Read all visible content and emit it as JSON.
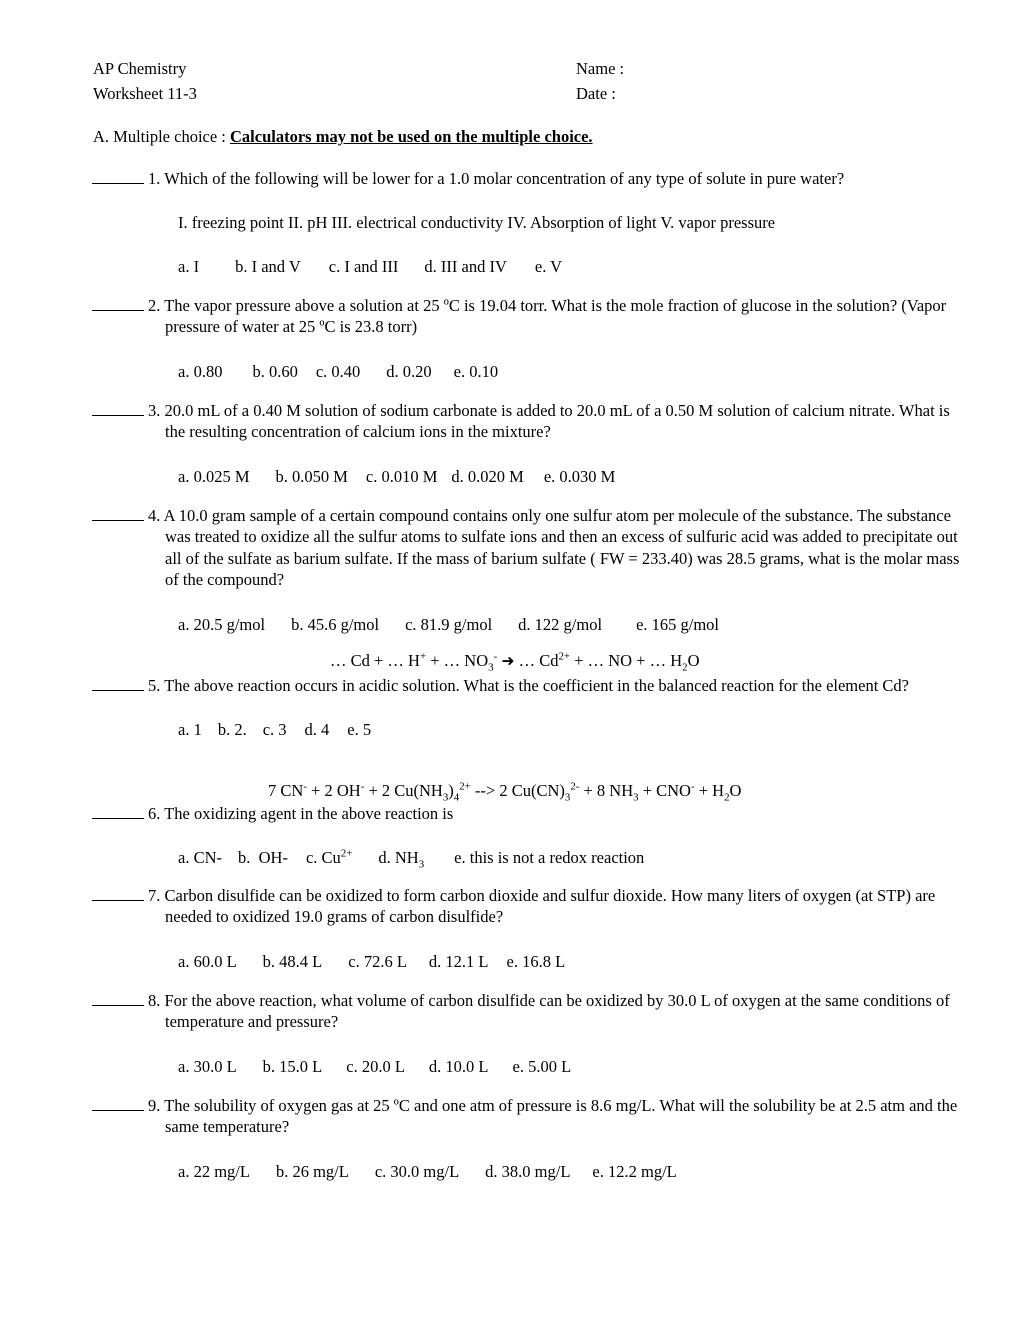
{
  "header": {
    "course": "AP Chemistry",
    "worksheet": "Worksheet 11-3",
    "name_label": "Name :",
    "date_label": "Date :"
  },
  "section": {
    "prefix": "A. Multiple choice : ",
    "emphasis": "Calculators may not be used on the multiple choice."
  },
  "questions": [
    {
      "number": "1.",
      "text": "Which of the following will be lower for a 1.0 molar concentration of any type of solute in pure water?",
      "roman_list": "I. freezing point    II. pH      III. electrical conductivity    IV. Absorption of light    V. vapor pressure",
      "options": [
        "a. I",
        "b. I and V",
        "c.  I and III",
        "d. III and IV",
        "e. V"
      ]
    },
    {
      "number": "2.",
      "text": "The vapor pressure above a solution at 25 ºC is 19.04 torr. What is the mole fraction of glucose in the solution? (Vapor pressure of water at 25 ºC is 23.8 torr)",
      "options": [
        "a. 0.80",
        "b. 0.60",
        "c. 0.40",
        "d. 0.20",
        "e. 0.10"
      ]
    },
    {
      "number": "3.",
      "text": "20.0 mL of a 0.40 M solution of sodium carbonate is added to 20.0 mL of a 0.50 M solution of calcium nitrate. What is the resulting concentration of calcium ions in the mixture?",
      "options": [
        "a. 0.025 M",
        "b.  0.050 M",
        "c. 0.010 M",
        "d. 0.020 M",
        "e. 0.030 M"
      ]
    },
    {
      "number": "4.",
      "text": "A 10.0 gram sample of a certain compound contains only one sulfur atom per molecule of the substance. The substance was treated to oxidize all the sulfur atoms to sulfate ions and then an excess of sulfuric acid was added to precipitate out all of the sulfate as barium sulfate. If the mass of barium sulfate ( FW = 233.40) was 28.5 grams, what is the molar mass of the compound?",
      "options": [
        "a. 20.5 g/mol",
        "b. 45.6 g/mol",
        "c. 81.9 g/mol",
        "d. 122 g/mol",
        "e. 165 g/mol"
      ]
    },
    {
      "number": "5.",
      "text": "The above reaction occurs in acidic solution. What is the coefficient in the balanced reaction for the element Cd?",
      "options": [
        "a. 1",
        "b.  2.",
        "c. 3",
        "d.  4",
        "e. 5"
      ]
    },
    {
      "number": "6.",
      "text": "The oxidizing agent in the above reaction is",
      "options": [
        "a. CN-",
        "b.  OH-",
        "c. Cu2+",
        "d. NH3",
        "e. this is not a redox reaction"
      ]
    },
    {
      "number": "7.",
      "text": "Carbon disulfide can be oxidized to form carbon dioxide and sulfur dioxide. How many liters of oxygen (at STP) are needed to oxidized 19.0 grams of carbon disulfide?",
      "options": [
        "a. 60.0 L",
        "b. 48.4 L",
        "c. 72.6 L",
        "d.   12.1 L",
        "e. 16.8 L"
      ]
    },
    {
      "number": "8.",
      "text": "For the above reaction, what volume of carbon disulfide can be oxidized by 30.0 L of oxygen at the same conditions of temperature and pressure?",
      "options": [
        "a. 30.0 L",
        "b. 15.0 L",
        "c. 20.0 L",
        "d. 10.0 L",
        "e. 5.00 L"
      ]
    },
    {
      "number": "9.",
      "text": "The solubility of oxygen gas at 25 ºC and one atm of pressure is 8.6 mg/L. What will the solubility be at 2.5 atm and the same temperature?",
      "options": [
        "a. 22 mg/L",
        "b. 26 mg/L",
        "c. 30.0 mg/L",
        "d.  38.0 mg/L",
        "e.  12.2 mg/L"
      ]
    }
  ],
  "equations": {
    "redox_cd": "… Cd + … H+ + … NO3- ➔ … Cd2+ + … NO + … H2O",
    "cyanide": "7 CN- + 2 OH- + 2 Cu(NH3)42+ --> 2 Cu(CN)32- + 8 NH3 + CNO- + H2O"
  }
}
